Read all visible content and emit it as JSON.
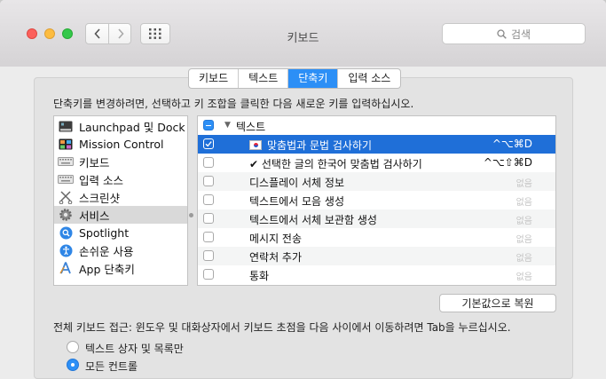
{
  "window": {
    "title": "키보드"
  },
  "search": {
    "placeholder": "검색"
  },
  "tabs": [
    {
      "label": "키보드",
      "active": false
    },
    {
      "label": "텍스트",
      "active": false
    },
    {
      "label": "단축키",
      "active": true
    },
    {
      "label": "입력 소스",
      "active": false
    }
  ],
  "instruction": "단축키를 변경하려면, 선택하고 키 조합을 클릭한 다음 새로운 키를 입력하십시오.",
  "categories": [
    {
      "label": "Launchpad 및 Dock",
      "icon": "launchpad-dock-icon"
    },
    {
      "label": "Mission Control",
      "icon": "mission-control-icon"
    },
    {
      "label": "키보드",
      "icon": "keyboard-icon"
    },
    {
      "label": "입력 소스",
      "icon": "input-source-keyboard-icon"
    },
    {
      "label": "스크린샷",
      "icon": "screenshot-icon"
    },
    {
      "label": "서비스",
      "icon": "gear-icon",
      "selected": true
    },
    {
      "label": "Spotlight",
      "icon": "spotlight-icon"
    },
    {
      "label": "손쉬운 사용",
      "icon": "accessibility-icon"
    },
    {
      "label": "App 단축키",
      "icon": "app-shortcuts-icon"
    }
  ],
  "shortcuts": {
    "group_label": "텍스트",
    "rows": [
      {
        "label": "맞춤법과 문법 검사하기",
        "keys": "^⌥⌘D",
        "checked": true,
        "selected": true
      },
      {
        "label": "✔ 선택한 글의 한국어 맞춤법 검사하기",
        "keys": "^⌥⇧⌘D",
        "checked": false
      },
      {
        "label": "디스플레이 서체 정보",
        "keys": "없음",
        "checked": false
      },
      {
        "label": "텍스트에서 모음 생성",
        "keys": "없음",
        "checked": false
      },
      {
        "label": "텍스트에서 서체 보관함 생성",
        "keys": "없음",
        "checked": false
      },
      {
        "label": "메시지 전송",
        "keys": "없음",
        "checked": false
      },
      {
        "label": "연락처 추가",
        "keys": "없음",
        "checked": false
      },
      {
        "label": "통화",
        "keys": "없음",
        "checked": false
      }
    ]
  },
  "restore_button": "기본값으로 복원",
  "full_keyboard_access": {
    "label": "전체 키보드 접근: 윈도우 및 대화상자에서 키보드 초점을 다음 사이에서 이동하려면 Tab을 누르십시오.",
    "options": [
      {
        "label": "텍스트 상자 및 목록만",
        "selected": false
      },
      {
        "label": "모든 컨트롤",
        "selected": true
      }
    ]
  },
  "colors": {
    "accent": "#2c8ff6",
    "selection": "#1f6fd8"
  }
}
